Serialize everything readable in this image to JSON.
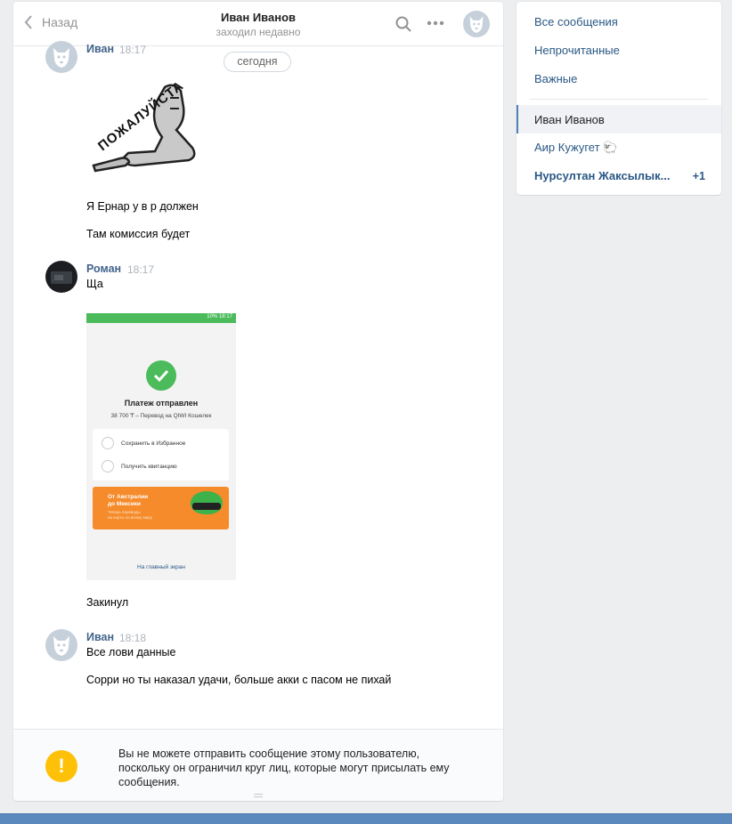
{
  "header": {
    "back_label": "Назад",
    "peer_name": "Иван Иванов",
    "peer_status": "заходил недавно"
  },
  "date_divider": "сегодня",
  "messages": [
    {
      "author": "Иван",
      "time": "18:17",
      "sticker_text": "ПОЖАЛУЙСТА",
      "texts": [
        "Я Ернар у в р должен",
        "Там комиссия будет"
      ]
    },
    {
      "author": "Роман",
      "time": "18:17",
      "texts": [
        "Ща"
      ],
      "attachment": {
        "status_time": "10% 18:17",
        "title": "Платеж отправлен",
        "subtitle": "38 700 ₸ – Перевод на QIWI Кошелек",
        "row1": "Сохранить в Избранное",
        "row2": "Получить квитанцию",
        "promo_title": "От Австралии\nдо Мексики",
        "promo_sub": "Теперь переводы\nна карты по всему миру",
        "link": "На главный экран"
      },
      "after_texts": [
        "Закинул"
      ]
    },
    {
      "author": "Иван",
      "time": "18:18",
      "texts": [
        "Все лови данные",
        "Сорри но ты наказал удачи, больше акки с пасом не пихай"
      ]
    }
  ],
  "footer": {
    "warning": "Вы не можете отправить сообщение этому пользователю, поскольку он ограничил круг лиц, которые могут присылать ему сообщения."
  },
  "nav": {
    "all": "Все сообщения",
    "unread": "Непрочитанные",
    "important": "Важные",
    "active_chat": "Иван Иванов",
    "chat2": "Аир Кужугет 🐑",
    "chat3": "Нурсултан Жаксылык...",
    "chat3_badge": "+1"
  },
  "colors": {
    "link": "#2a5885",
    "author": "#42648b",
    "accent": "#5181b8",
    "warning": "#ffc107",
    "qiwi_green": "#4bbb5b"
  }
}
